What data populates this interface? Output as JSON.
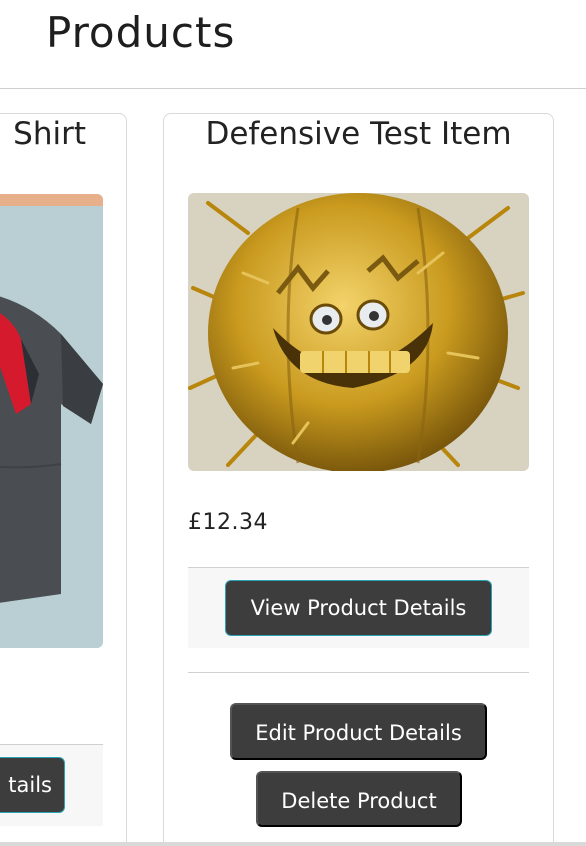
{
  "page": {
    "title": "Products"
  },
  "products": [
    {
      "name": "Shirt",
      "view_label": "tails",
      "image": "shirt-image"
    },
    {
      "name": "Defensive Test Item",
      "price": "£12.34",
      "view_label": "View Product Details",
      "edit_label": "Edit Product Details",
      "delete_label": "Delete Product",
      "image": "golden-spiky-face-image"
    }
  ],
  "colors": {
    "button_bg": "#3d3d3d",
    "button_focus_border": "#2aa3b5",
    "footer_bg": "#f7f7f7"
  }
}
